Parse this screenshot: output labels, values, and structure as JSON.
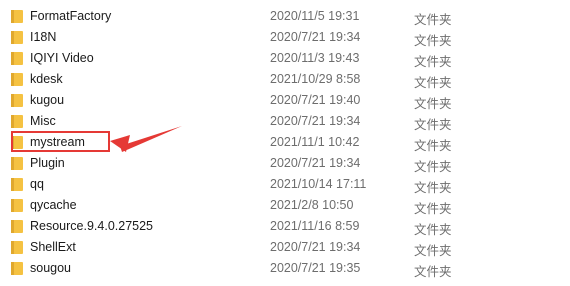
{
  "files": [
    {
      "name": "FormatFactory",
      "date": "2020/11/5 19:31",
      "type": "文件夹"
    },
    {
      "name": "I18N",
      "date": "2020/7/21 19:34",
      "type": "文件夹"
    },
    {
      "name": "IQIYI Video",
      "date": "2020/11/3 19:43",
      "type": "文件夹"
    },
    {
      "name": "kdesk",
      "date": "2021/10/29 8:58",
      "type": "文件夹"
    },
    {
      "name": "kugou",
      "date": "2020/7/21 19:40",
      "type": "文件夹"
    },
    {
      "name": "Misc",
      "date": "2020/7/21 19:34",
      "type": "文件夹"
    },
    {
      "name": "mystream",
      "date": "2021/11/1 10:42",
      "type": "文件夹"
    },
    {
      "name": "Plugin",
      "date": "2020/7/21 19:34",
      "type": "文件夹"
    },
    {
      "name": "qq",
      "date": "2021/10/14 17:11",
      "type": "文件夹"
    },
    {
      "name": "qycache",
      "date": "2021/2/8 10:50",
      "type": "文件夹"
    },
    {
      "name": "Resource.9.4.0.27525",
      "date": "2021/11/16 8:59",
      "type": "文件夹"
    },
    {
      "name": "ShellExt",
      "date": "2020/7/21 19:34",
      "type": "文件夹"
    },
    {
      "name": "sougou",
      "date": "2020/7/21 19:35",
      "type": "文件夹"
    }
  ],
  "colors": {
    "folder": "#f5c242",
    "folder_dark": "#e0a82e",
    "annotation": "#e53935"
  },
  "icons": {
    "folder": "folder-icon",
    "annotation": "red-arrow-icon"
  }
}
